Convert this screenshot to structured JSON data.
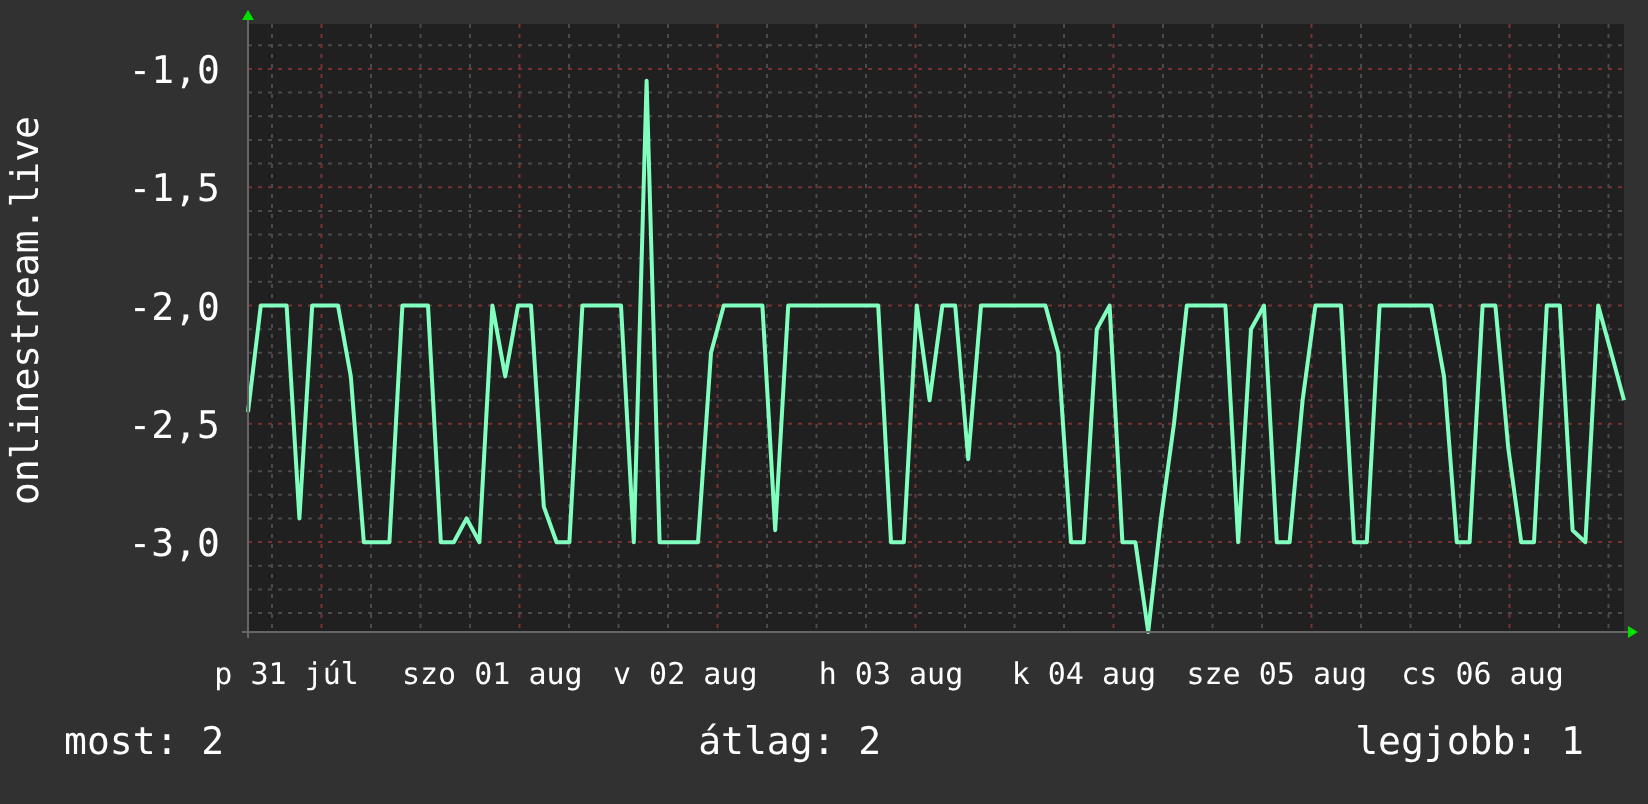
{
  "graph": {
    "chart_data": {
      "type": "line",
      "ylabel": "onlinestream.live",
      "grid": true,
      "ylim": [
        -3.38,
        -0.81
      ],
      "categories": [
        null,
        null,
        null,
        "p 31 júl",
        null,
        null,
        null,
        null,
        null,
        null,
        null,
        null,
        null,
        null,
        null,
        null,
        null,
        null,
        null,
        "szo 01 aug",
        null,
        null,
        null,
        null,
        null,
        null,
        null,
        null,
        null,
        null,
        null,
        null,
        null,
        null,
        "v 02 aug",
        null,
        null,
        null,
        null,
        null,
        null,
        null,
        null,
        null,
        null,
        null,
        null,
        null,
        null,
        null,
        "h 03 aug",
        null,
        null,
        null,
        null,
        null,
        null,
        null,
        null,
        null,
        null,
        null,
        null,
        null,
        null,
        "k 04 aug",
        null,
        null,
        null,
        null,
        null,
        null,
        null,
        null,
        null,
        null,
        null,
        null,
        null,
        null,
        "sze 05 aug",
        null,
        null,
        null,
        null,
        null,
        null,
        null,
        null,
        null,
        null,
        null,
        null,
        null,
        null,
        null,
        "cs 06 aug",
        null,
        null,
        null,
        null,
        null,
        null,
        null,
        null,
        null,
        null,
        null
      ],
      "yticks": [
        {
          "value": -1.0,
          "label": "-1,0"
        },
        {
          "value": -1.5,
          "label": "-1,5"
        },
        {
          "value": -2.0,
          "label": "-2,0"
        },
        {
          "value": -2.5,
          "label": "-2,5"
        },
        {
          "value": -3.0,
          "label": "-3,0"
        }
      ],
      "series": [
        {
          "color": "#80ffbf",
          "values": [
            -2.45,
            -2,
            -2,
            -2,
            -2.9,
            -2,
            -2,
            -2,
            -2.3,
            -3,
            -3,
            -3,
            -2,
            -2,
            -2,
            -3,
            -3,
            -2.9,
            -3,
            -2,
            -2.3,
            -2,
            -2,
            -2.85,
            -3,
            -3,
            -2,
            -2,
            -2,
            -2,
            -3,
            -1.05,
            -3,
            -3,
            -3,
            -3,
            -2.2,
            -2,
            -2,
            -2,
            -2,
            -2.95,
            -2,
            -2,
            -2,
            -2,
            -2,
            -2,
            -2,
            -2,
            -3,
            -3,
            -2,
            -2.4,
            -2,
            -2,
            -2.65,
            -2,
            -2,
            -2,
            -2,
            -2,
            -2,
            -2.2,
            -3,
            -3,
            -2.1,
            -2,
            -3,
            -3,
            -3.38,
            -2.9,
            -2.5,
            -2,
            -2,
            -2,
            -2,
            -3,
            -2.1,
            -2,
            -3,
            -3,
            -2.4,
            -2,
            -2,
            -2,
            -3,
            -3,
            -2,
            -2,
            -2,
            -2,
            -2,
            -2.3,
            -3,
            -3,
            -2,
            -2,
            -2.6,
            -3,
            -3,
            -2,
            -2,
            -2.95,
            -3,
            -2,
            -2.2,
            -2.4
          ]
        }
      ]
    }
  },
  "legend": [
    {
      "label": "most: 2"
    },
    {
      "label": "átlag: 2"
    },
    {
      "label": "legjobb: 1"
    }
  ]
}
